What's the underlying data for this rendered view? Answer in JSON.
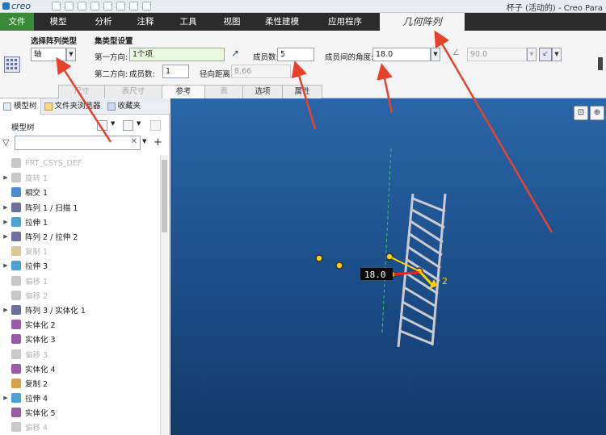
{
  "titlebar": {
    "logo": "creo",
    "window_title": "杯子 (活动的) - Creo Para"
  },
  "ribbon_tabs": [
    "文件",
    "模型",
    "分析",
    "注释",
    "工具",
    "视图",
    "柔性建模",
    "应用程序",
    "几何阵列"
  ],
  "pattern": {
    "type_label": "选择阵列类型",
    "type_value": "轴",
    "set_label": "集类型设置",
    "dir1_label": "第一方向:",
    "dir1_value": "1个项",
    "dir2_label": "第二方向:",
    "members_label": "成员数:",
    "members_value": "5",
    "members2_label": "成员数:",
    "members2_value": "1",
    "angle_label": "成员间的角度:",
    "angle_value": "18.0",
    "radial_label": "径向距离:",
    "radial_value": "8.66",
    "angle2_value": "90.0"
  },
  "sub_tabs": [
    "尺寸",
    "表尺寸",
    "参考",
    "表",
    "选项",
    "属性"
  ],
  "nav_tabs": [
    "模型树",
    "文件夹浏览器",
    "收藏夹"
  ],
  "tree_title": "模型树",
  "tree_items": [
    {
      "label": "PRT_CSYS_DEF",
      "dim": true,
      "expand": false,
      "icon": "csys-icon",
      "color": "#c8c8c8"
    },
    {
      "label": "旋转 1",
      "dim": true,
      "expand": true,
      "icon": "revolve-icon",
      "color": "#c8c8c8"
    },
    {
      "label": "相交 1",
      "dim": false,
      "expand": false,
      "icon": "intersect-icon",
      "color": "#4a8cd4"
    },
    {
      "label": "阵列 1 / 扫描 1",
      "dim": false,
      "expand": true,
      "icon": "pattern-icon",
      "color": "#6f6f9f"
    },
    {
      "label": "拉伸 1",
      "dim": false,
      "expand": true,
      "icon": "extrude-icon",
      "color": "#4aa0d8"
    },
    {
      "label": "阵列 2 / 拉伸 2",
      "dim": false,
      "expand": true,
      "icon": "pattern-icon",
      "color": "#6f6f9f"
    },
    {
      "label": "复制 1",
      "dim": true,
      "expand": false,
      "icon": "copy-icon",
      "color": "#d8c898"
    },
    {
      "label": "拉伸 3",
      "dim": false,
      "expand": true,
      "icon": "extrude-icon",
      "color": "#4aa0d8"
    },
    {
      "label": "偏移 1",
      "dim": true,
      "expand": false,
      "icon": "offset-icon",
      "color": "#c8c8c8"
    },
    {
      "label": "偏移 2",
      "dim": true,
      "expand": false,
      "icon": "offset-icon",
      "color": "#c8c8c8"
    },
    {
      "label": "阵列 3 / 实体化 1",
      "dim": false,
      "expand": true,
      "icon": "pattern-icon",
      "color": "#6f6f9f"
    },
    {
      "label": "实体化 2",
      "dim": false,
      "expand": false,
      "icon": "solidify-icon",
      "color": "#9a5aa8"
    },
    {
      "label": "实体化 3",
      "dim": false,
      "expand": false,
      "icon": "solidify-icon",
      "color": "#9a5aa8"
    },
    {
      "label": "偏移 3",
      "dim": true,
      "expand": false,
      "icon": "offset-icon",
      "color": "#c8c8c8"
    },
    {
      "label": "实体化 4",
      "dim": false,
      "expand": false,
      "icon": "solidify-icon",
      "color": "#9a5aa8"
    },
    {
      "label": "复制 2",
      "dim": false,
      "expand": false,
      "icon": "copy-icon",
      "color": "#d8a048"
    },
    {
      "label": "拉伸 4",
      "dim": false,
      "expand": true,
      "icon": "extrude-icon",
      "color": "#4aa0d8"
    },
    {
      "label": "实体化 5",
      "dim": false,
      "expand": false,
      "icon": "solidify-icon",
      "color": "#9a5aa8"
    },
    {
      "label": "偏移 4",
      "dim": true,
      "expand": false,
      "icon": "offset-icon",
      "color": "#c8c8c8"
    }
  ],
  "viewport": {
    "angle_tag": "18.0",
    "dir_label": "2"
  },
  "colors": {
    "file_tab": "#3a8a3a",
    "viewport": "#1c4f8a",
    "annotation_arrow": "#e8412c",
    "handle_yellow": "#ffd200",
    "model_gray": "#c9cbd1"
  }
}
